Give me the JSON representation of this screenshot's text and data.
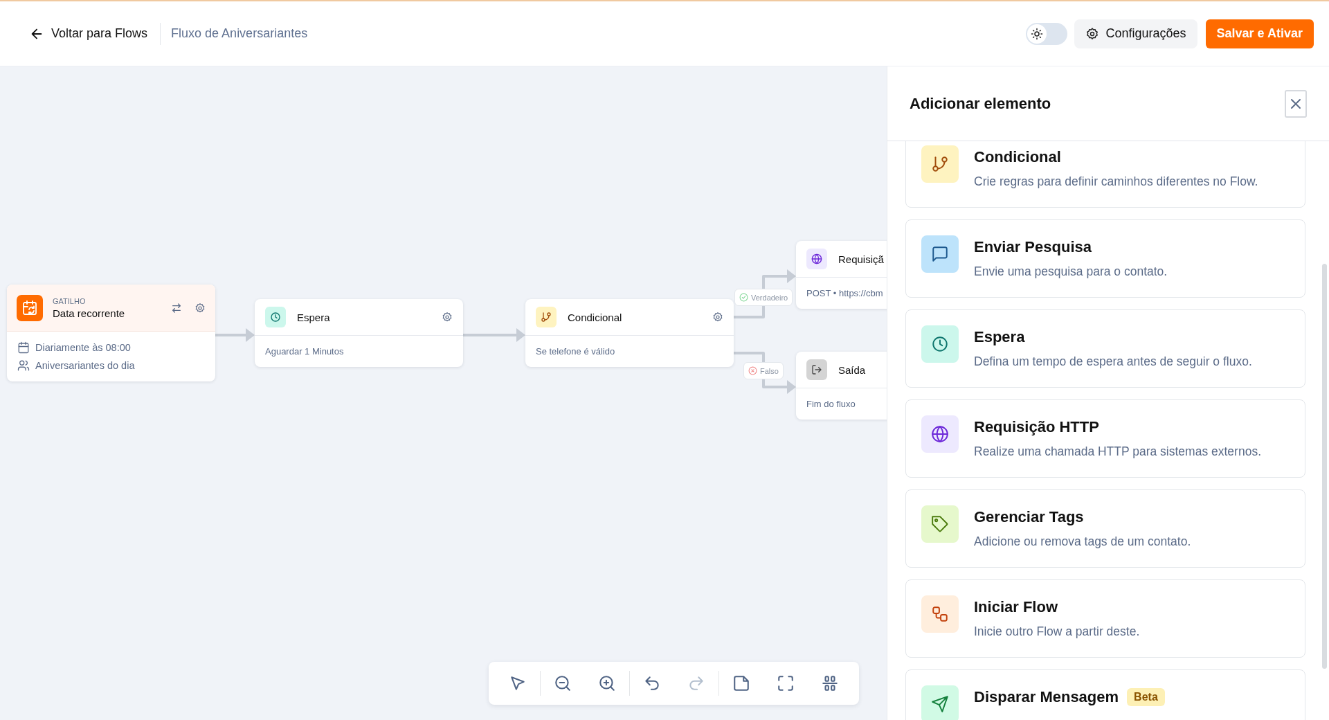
{
  "header": {
    "back_link": "Voltar para Flows",
    "flow_title": "Fluxo de Aniversariantes",
    "theme_toggle": {
      "on": false
    },
    "settings_button": "Configurações",
    "save_button": "Salvar e Ativar"
  },
  "nodes": [
    {
      "kind": "trigger",
      "label": "GATILHO",
      "title": "Data recorrente",
      "details": [
        {
          "kind": "schedule",
          "text": "Diariamente às 08:00"
        },
        {
          "kind": "audience",
          "text": "Aniversariantes do dia"
        }
      ]
    },
    {
      "kind": "wait",
      "title": "Espera",
      "subtitle": "Aguardar 1 Minutos"
    },
    {
      "kind": "condition",
      "title": "Condicional",
      "subtitle": "Se telefone é válido"
    },
    {
      "kind": "http",
      "title": "Requisiçã",
      "subtitle": "POST • https://cbm"
    },
    {
      "kind": "exit",
      "title": "Saída",
      "subtitle": "Fim do fluxo"
    }
  ],
  "branches": [
    {
      "kind": "true",
      "label": "Verdadeiro"
    },
    {
      "kind": "false",
      "label": "Falso"
    }
  ],
  "toolbar": [
    {
      "kind": "select",
      "disabled": false
    },
    {
      "kind": "zoom_out",
      "disabled": false
    },
    {
      "kind": "zoom_in",
      "disabled": false
    },
    {
      "kind": "undo",
      "disabled": false
    },
    {
      "kind": "redo",
      "disabled": true
    },
    {
      "kind": "note",
      "disabled": false
    },
    {
      "kind": "fit",
      "disabled": false
    },
    {
      "kind": "align",
      "disabled": false
    }
  ],
  "panel": {
    "title": "Adicionar elemento",
    "items": [
      {
        "kind": "condition",
        "title": "Condicional",
        "description": "Crie regras para definir caminhos diferentes no Flow."
      },
      {
        "kind": "survey",
        "title": "Enviar Pesquisa",
        "description": "Envie uma pesquisa para o contato."
      },
      {
        "kind": "wait",
        "title": "Espera",
        "description": "Defina um tempo de espera antes de seguir o fluxo."
      },
      {
        "kind": "http",
        "title": "Requisição HTTP",
        "description": "Realize uma chamada HTTP para sistemas externos."
      },
      {
        "kind": "tags",
        "title": "Gerenciar Tags",
        "description": "Adicione ou remova tags de um contato."
      },
      {
        "kind": "start_flow",
        "title": "Iniciar Flow",
        "description": "Inicie outro Flow a partir deste."
      },
      {
        "kind": "message",
        "title": "Disparar Mensagem",
        "badge": "Beta"
      }
    ]
  }
}
